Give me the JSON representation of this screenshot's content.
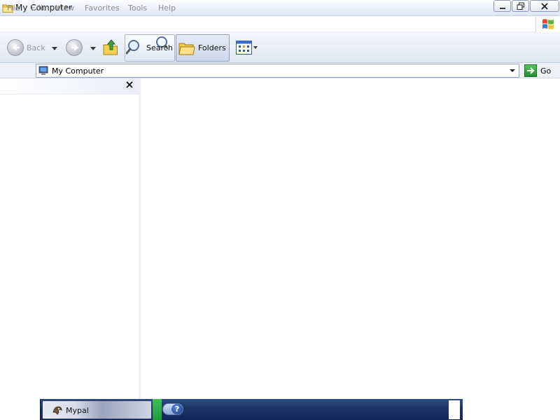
{
  "window": {
    "title": "My Computer",
    "title_icon": "folder-icon",
    "controls": [
      "minimize-icon",
      "maximize-icon",
      "close-icon"
    ]
  },
  "menu": {
    "items": [
      "File",
      "Edit",
      "View",
      "Favorites",
      "Tools",
      "Help"
    ],
    "logo_icon": "windows-logo-icon"
  },
  "toolbar": {
    "back_label": "Back",
    "search_label": "Search",
    "folders_label": "Folders",
    "icons": {
      "back": "back-arrow-icon",
      "forward": "forward-arrow-icon",
      "up": "up-folder-icon",
      "search": "magnifier-icon",
      "folders": "folders-icon",
      "views": "views-icon"
    }
  },
  "address": {
    "value": "My Computer",
    "go_label": "Go",
    "icon": "my-computer-icon"
  },
  "left_pane": {
    "close_icon": "close-icon"
  },
  "taskbar": {
    "task_label": "Mypal",
    "task_icon": "mypal-icon",
    "tray_icon": "help-icon",
    "help_glyph": "?"
  },
  "colors": {
    "taskbar": "#1c3568",
    "tray_green": "#2eae48",
    "go_green": "#2a9a38"
  }
}
